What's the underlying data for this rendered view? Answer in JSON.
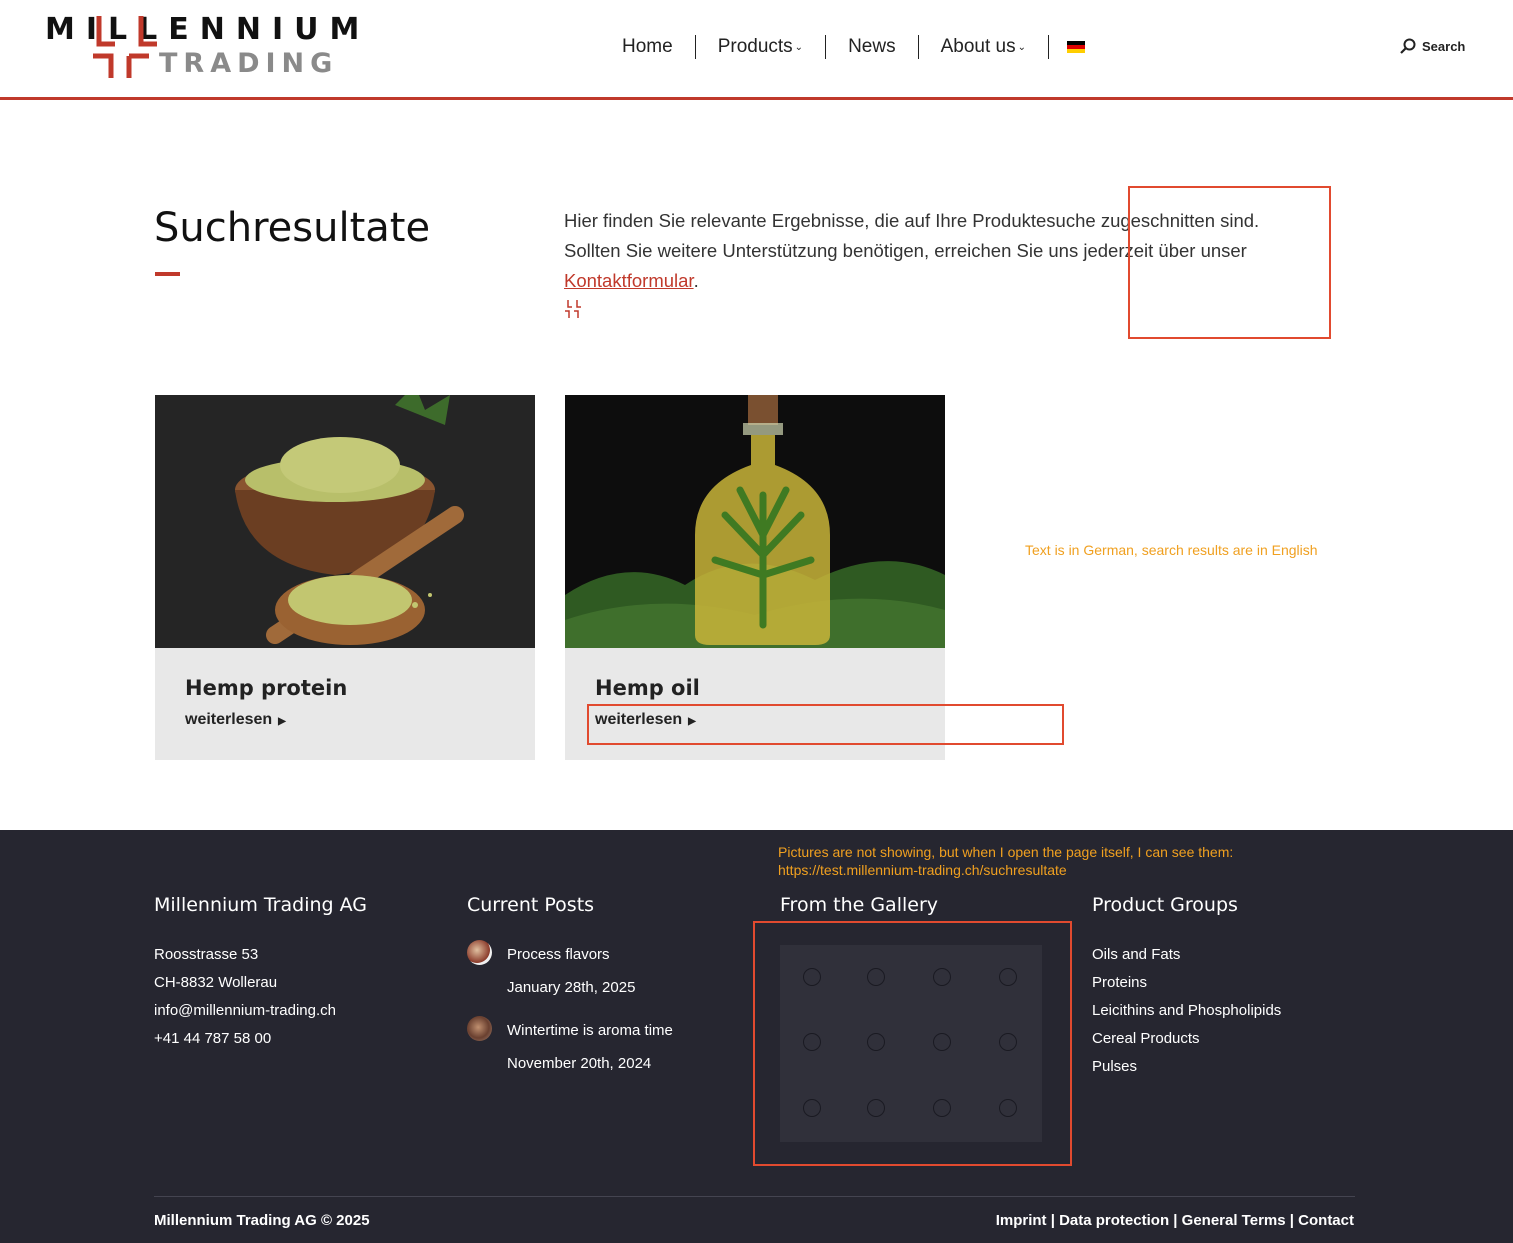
{
  "header": {
    "logo_line1": "MILLENNIUM",
    "logo_line2": "TRADING",
    "nav": [
      {
        "label": "Home"
      },
      {
        "label": "Products",
        "dropdown": true
      },
      {
        "label": "News"
      },
      {
        "label": "About us",
        "dropdown": true
      }
    ],
    "caret": "⌄",
    "language_flag": "de-flag",
    "search_label": "Search",
    "accent_color": "#c0392b"
  },
  "intro": {
    "title": "Suchresultate",
    "text": "Hier finden Sie relevante Ergebnisse, die auf Ihre Produktesuche zugeschnitten sind. Sollten Sie weitere Unterstützung benötigen, erreichen Sie uns jederzeit über unser ",
    "link_text": "Kontaktformular",
    "suffix": "."
  },
  "results": [
    {
      "title": "Hemp protein",
      "more": "weiterlesen"
    },
    {
      "title": "Hemp oil",
      "more": "weiterlesen"
    }
  ],
  "annotations": {
    "note1": "Text is in German, search results are in English",
    "note2_line1": "Pictures are not showing, but when I open the page itself, I can see them:",
    "note2_line2": "https://test.millennium-trading.ch/suchresultate"
  },
  "footer": {
    "company": {
      "title": "Millennium Trading AG",
      "lines": [
        "Roosstrasse 53",
        "CH-8832 Wollerau",
        "info@millennium-trading.ch",
        "+41 44 787 58 00"
      ]
    },
    "posts": {
      "title": "Current Posts",
      "items": [
        {
          "title": "Process flavors",
          "date": "January 28th, 2025"
        },
        {
          "title": "Wintertime is aroma time",
          "date": "November 20th, 2024"
        }
      ]
    },
    "gallery": {
      "title": "From the Gallery"
    },
    "groups": {
      "title": "Product Groups",
      "items": [
        "Oils and Fats",
        "Proteins",
        "Leicithins and Phospholipids",
        "Cereal Products",
        "Pulses"
      ]
    },
    "copyright": "Millennium Trading AG © 2025",
    "links": [
      "Imprint",
      "Data protection",
      "General Terms",
      "Contact"
    ],
    "link_separator": " | "
  }
}
